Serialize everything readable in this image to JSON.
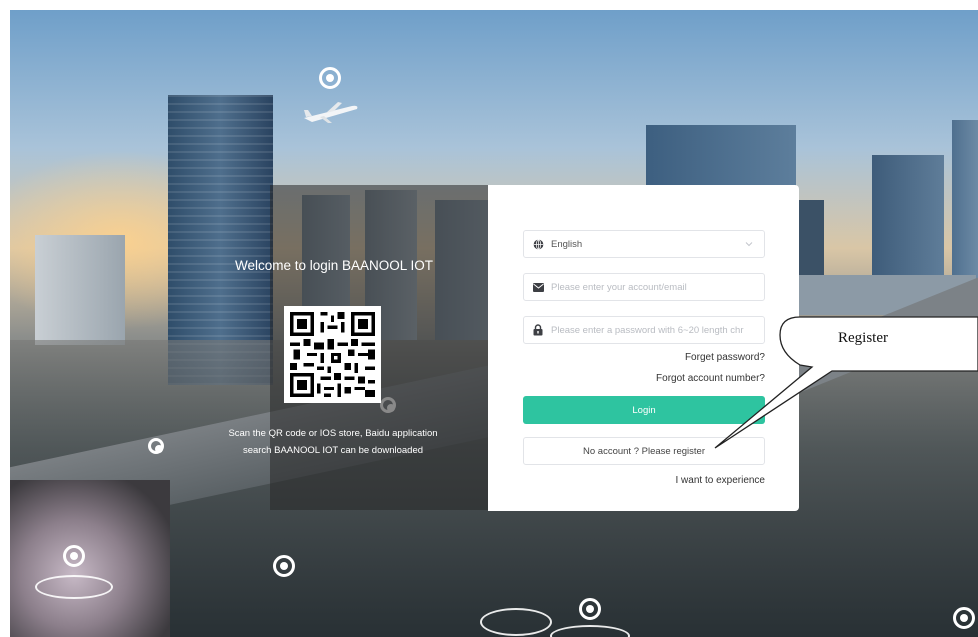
{
  "left_panel": {
    "welcome": "Welcome to login BAANOOL IOT",
    "scan_line1": "Scan the QR code or IOS store, Baidu application",
    "scan_line2": "search BAANOOL IOT can be downloaded"
  },
  "login_form": {
    "language_value": "English",
    "account_placeholder": "Please enter your account/email",
    "password_placeholder": "Please enter a password with 6~20 length chr",
    "forget_password": "Forget password?",
    "forgot_account": "Forgot account number?",
    "login_label": "Login",
    "register_label": "No account ? Please register",
    "experience_label": "I want to experience"
  },
  "annotation": {
    "callout_label": "Register"
  },
  "colors": {
    "accent": "#2ec4a0",
    "card_bg": "#ffffff",
    "overlay": "#282828"
  },
  "icons": {
    "language": "globe-icon",
    "account": "mail-icon",
    "password": "lock-icon",
    "dropdown": "chevron-down-icon",
    "qr": "qr-code-icon",
    "map_pin": "location-pin-icon",
    "plane": "airplane-icon"
  }
}
